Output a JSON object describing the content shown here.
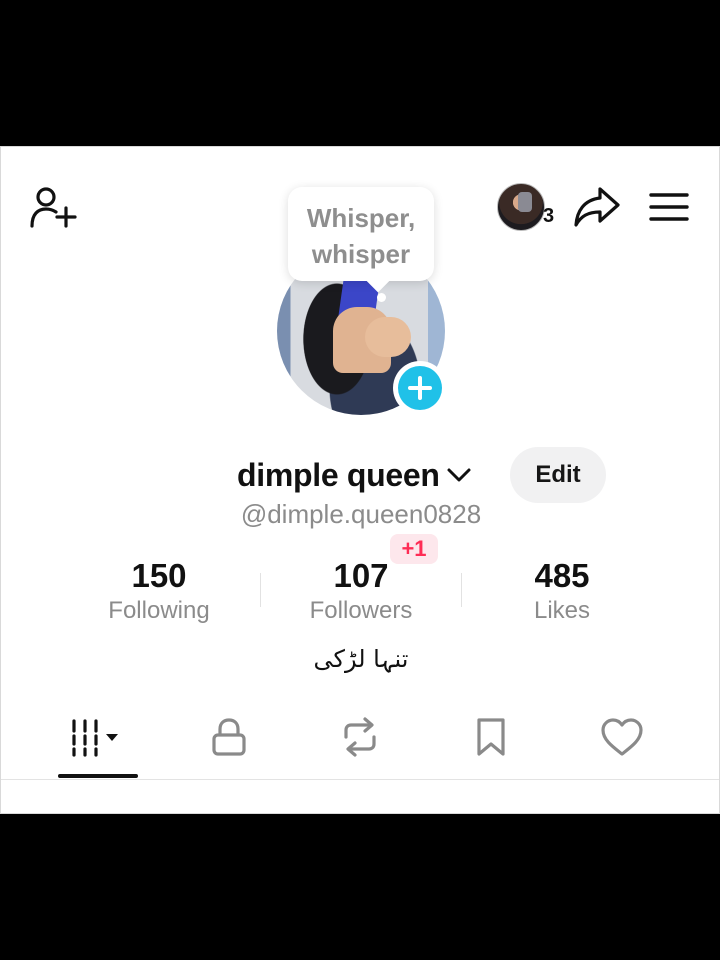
{
  "header": {
    "story_count": "3"
  },
  "bubble": {
    "line1": "Whisper,",
    "line2": "whisper"
  },
  "profile": {
    "display_name": "dimple queen",
    "username": "@dimple.queen0828",
    "edit_label": "Edit",
    "bio": "تنہا لڑکی"
  },
  "stats": {
    "following": {
      "value": "150",
      "label": "Following"
    },
    "followers": {
      "value": "107",
      "label": "Followers",
      "new_badge": "+1"
    },
    "likes": {
      "value": "485",
      "label": "Likes"
    }
  },
  "tabs": [
    {
      "name": "videos-grid-icon",
      "active": true
    },
    {
      "name": "lock-icon",
      "active": false
    },
    {
      "name": "repost-icon",
      "active": false
    },
    {
      "name": "bookmark-icon",
      "active": false
    },
    {
      "name": "heart-icon",
      "active": false
    }
  ],
  "colors": {
    "accent_blue": "#20c1e8",
    "badge_red": "#fe2c55",
    "secondary_text": "#8b8b8b"
  }
}
